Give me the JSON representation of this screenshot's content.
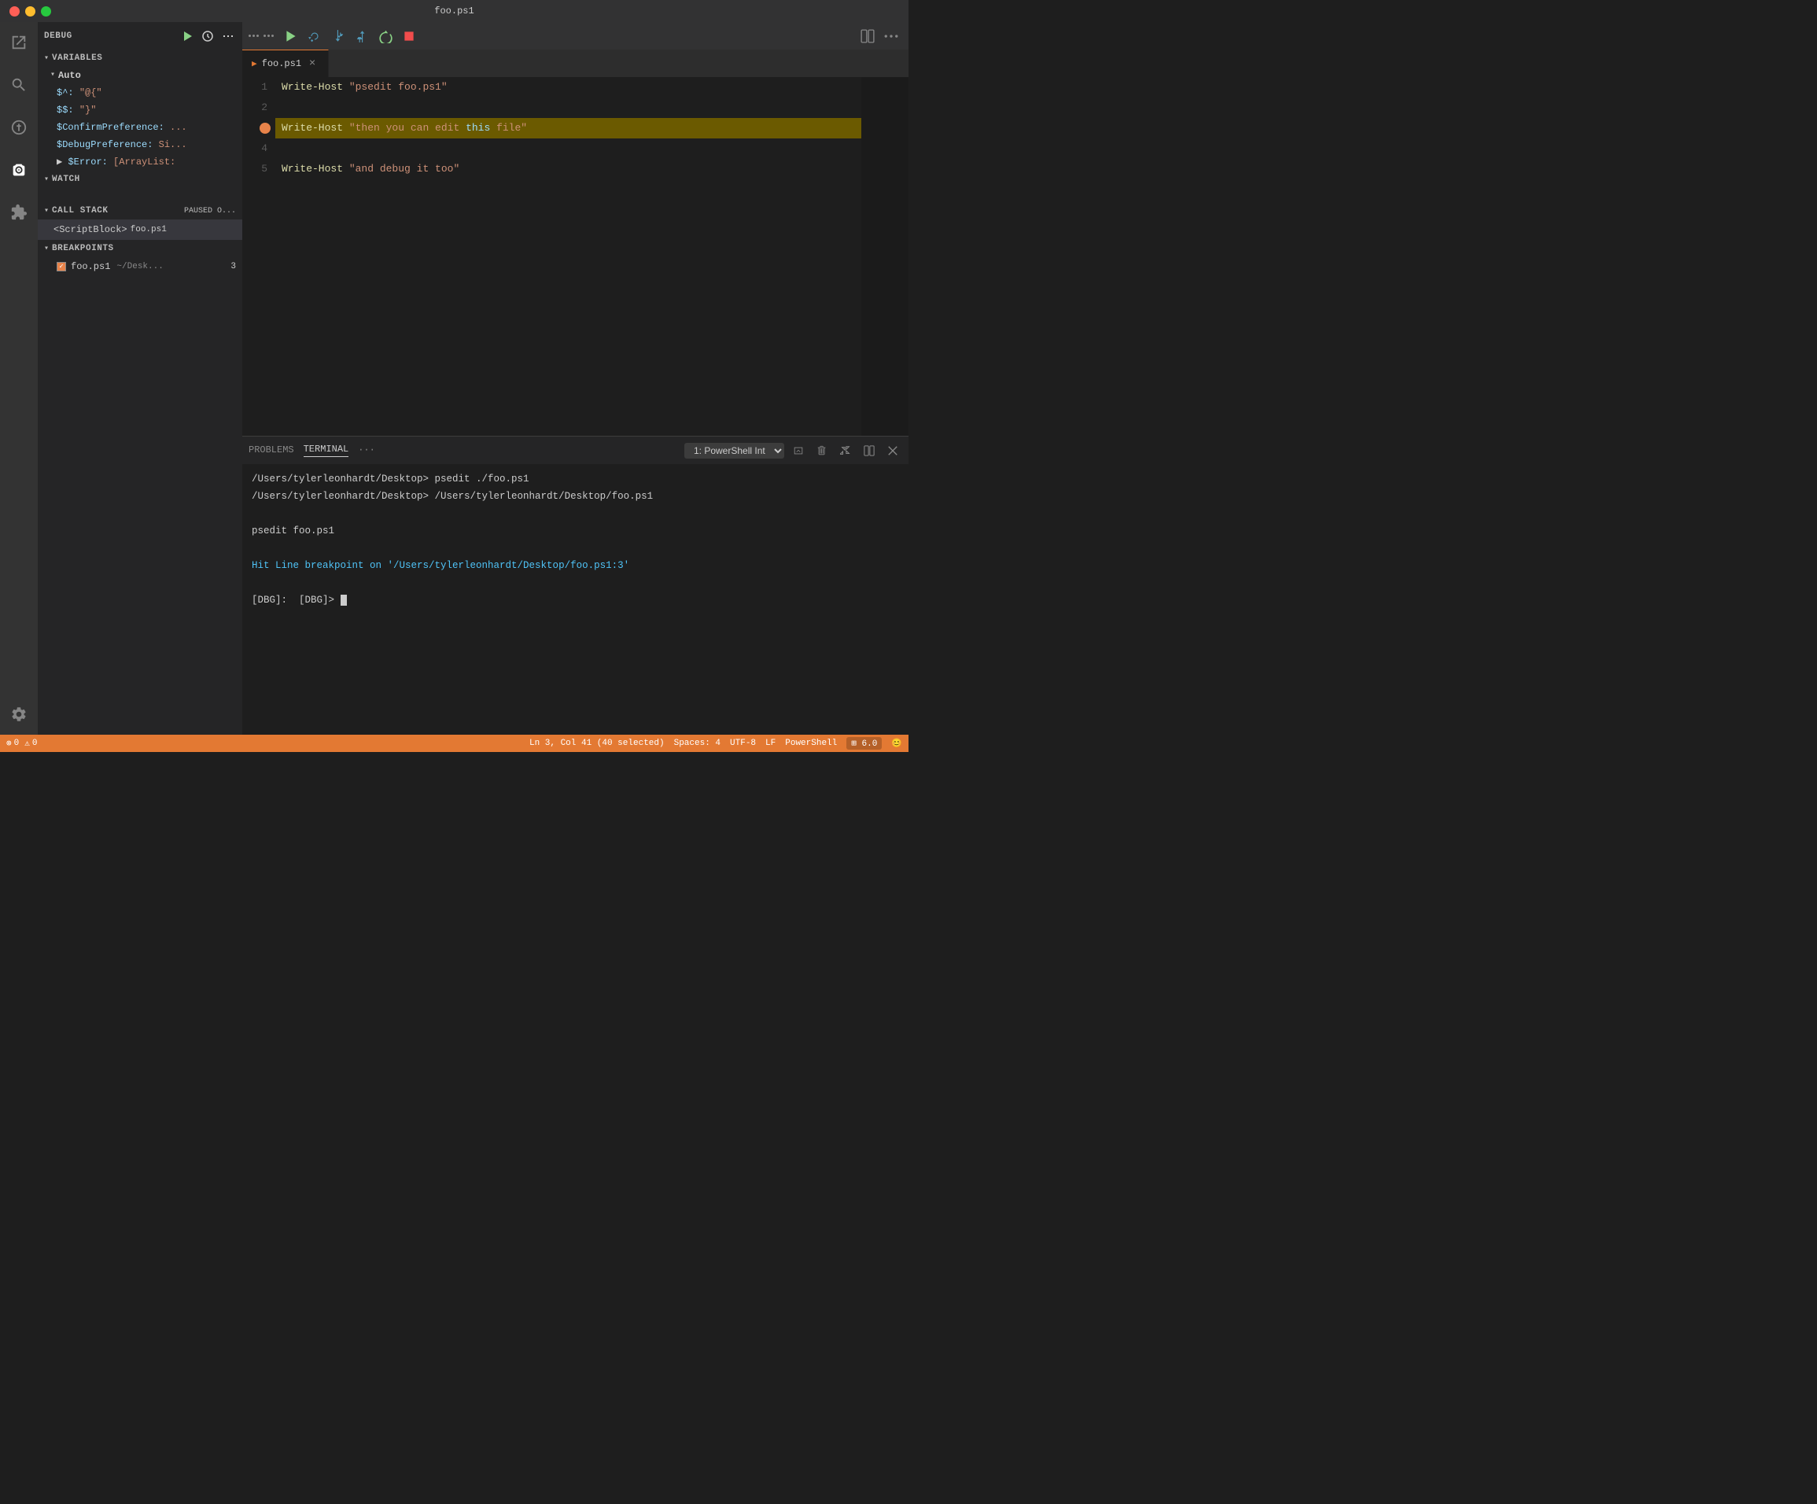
{
  "titlebar": {
    "title": "foo.ps1"
  },
  "activity_bar": {
    "icons": [
      {
        "name": "explorer-icon",
        "symbol": "📄",
        "active": false
      },
      {
        "name": "search-icon",
        "symbol": "🔍",
        "active": false
      },
      {
        "name": "git-icon",
        "symbol": "⎇",
        "active": false
      },
      {
        "name": "debug-icon",
        "symbol": "🐛",
        "active": true
      },
      {
        "name": "extensions-icon",
        "symbol": "⊞",
        "active": false
      }
    ],
    "bottom_icons": [
      {
        "name": "settings-icon",
        "symbol": "⚙",
        "active": false
      }
    ]
  },
  "sidebar": {
    "debug_label": "DEBUG",
    "sections": {
      "variables": {
        "label": "VARIABLES",
        "auto": {
          "label": "Auto",
          "items": [
            {
              "name": "$^:",
              "value": "\"@{\""
            },
            {
              "name": "$$:",
              "value": "\"}\""
            },
            {
              "name": "$ConfirmPreference:",
              "value": "..."
            },
            {
              "name": "$DebugPreference:",
              "value": "Si..."
            },
            {
              "name": "$Error:",
              "value": "[ArrayList:"
            }
          ]
        }
      },
      "watch": {
        "label": "WATCH"
      },
      "call_stack": {
        "label": "CALL STACK",
        "badge": "PAUSED O...",
        "items": [
          {
            "name": "<ScriptBlock>",
            "file": "foo.ps1"
          }
        ]
      },
      "breakpoints": {
        "label": "BREAKPOINTS",
        "items": [
          {
            "name": "foo.ps1",
            "path": "~/Desk...",
            "line": "3"
          }
        ]
      }
    }
  },
  "toolbar": {
    "buttons": [
      {
        "name": "continue-button",
        "label": "▶",
        "color": "green"
      },
      {
        "name": "step-over-button",
        "label": "↷",
        "color": "blue"
      },
      {
        "name": "step-into-button",
        "label": "↓",
        "color": "blue"
      },
      {
        "name": "step-out-button",
        "label": "↑",
        "color": "blue"
      },
      {
        "name": "restart-button",
        "label": "↺",
        "color": "green"
      },
      {
        "name": "stop-button",
        "label": "■",
        "color": "red"
      }
    ]
  },
  "editor": {
    "tab": {
      "icon": "▶",
      "name": "foo.ps1",
      "close": "×"
    },
    "lines": [
      {
        "number": "1",
        "content": "Write-Host \"psedit foo.ps1\"",
        "highlighted": false,
        "breakpoint": false
      },
      {
        "number": "2",
        "content": "",
        "highlighted": false,
        "breakpoint": false
      },
      {
        "number": "3",
        "content": "Write-Host \"then you can edit this file\"",
        "highlighted": true,
        "breakpoint": true
      },
      {
        "number": "4",
        "content": "",
        "highlighted": false,
        "breakpoint": false
      },
      {
        "number": "5",
        "content": "Write-Host \"and debug it too\"",
        "highlighted": false,
        "breakpoint": false
      }
    ]
  },
  "panel": {
    "tabs": [
      "PROBLEMS",
      "TERMINAL"
    ],
    "active_tab": "TERMINAL",
    "terminal_title": "1: PowerShell Int",
    "terminal_lines": [
      "/Users/tylerleonhardt/Desktop> psedit ./foo.ps1",
      "/Users/tylerleonhardt/Desktop> /Users/tylerleonhardt/Desktop/foo.ps1",
      "",
      "psedit foo.ps1",
      "",
      "Hit Line breakpoint on '/Users/tylerleonhardt/Desktop/foo.ps1:3'",
      "",
      "[DBG]:  [DBG]> "
    ]
  },
  "status_bar": {
    "errors": "0",
    "warnings": "0",
    "position": "Ln 3, Col 41 (40 selected)",
    "spaces": "Spaces: 4",
    "encoding": "UTF-8",
    "line_ending": "LF",
    "language": "PowerShell",
    "version": "⊞ 6.0",
    "emoji": "😊"
  }
}
